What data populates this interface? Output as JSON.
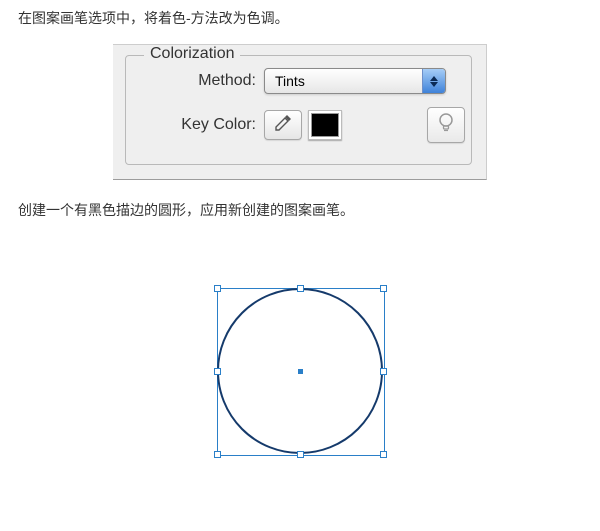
{
  "instructions": {
    "line1": "在图案画笔选项中，将着色-方法改为色调。",
    "line2": "创建一个有黑色描边的圆形，应用新创建的图案画笔。"
  },
  "panel": {
    "legend": "Colorization",
    "method_label": "Method:",
    "method_value": "Tints",
    "key_label": "Key Color:",
    "key_color": "#000000"
  }
}
